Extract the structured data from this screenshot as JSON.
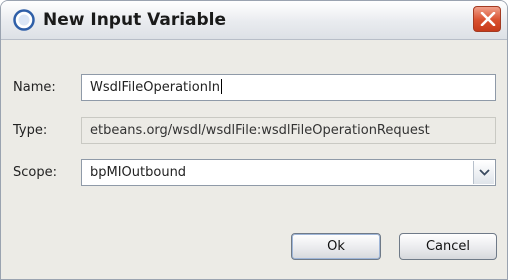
{
  "window": {
    "title": "New Input Variable",
    "icon": "info-globe-icon",
    "close_icon": "close-icon"
  },
  "form": {
    "name_label": "Name:",
    "name_value": "WsdlFileOperationIn",
    "type_label": "Type:",
    "type_value": "etbeans.org/wsdl/wsdlFile:wsdlFileOperationRequest",
    "scope_label": "Scope:",
    "scope_value": "bpMIOutbound"
  },
  "buttons": {
    "ok_label": "Ok",
    "cancel_label": "Cancel"
  },
  "colors": {
    "dialog_background": "#ecebe6",
    "close_button": "#d9502e",
    "title_icon": "#2f5fa8"
  }
}
